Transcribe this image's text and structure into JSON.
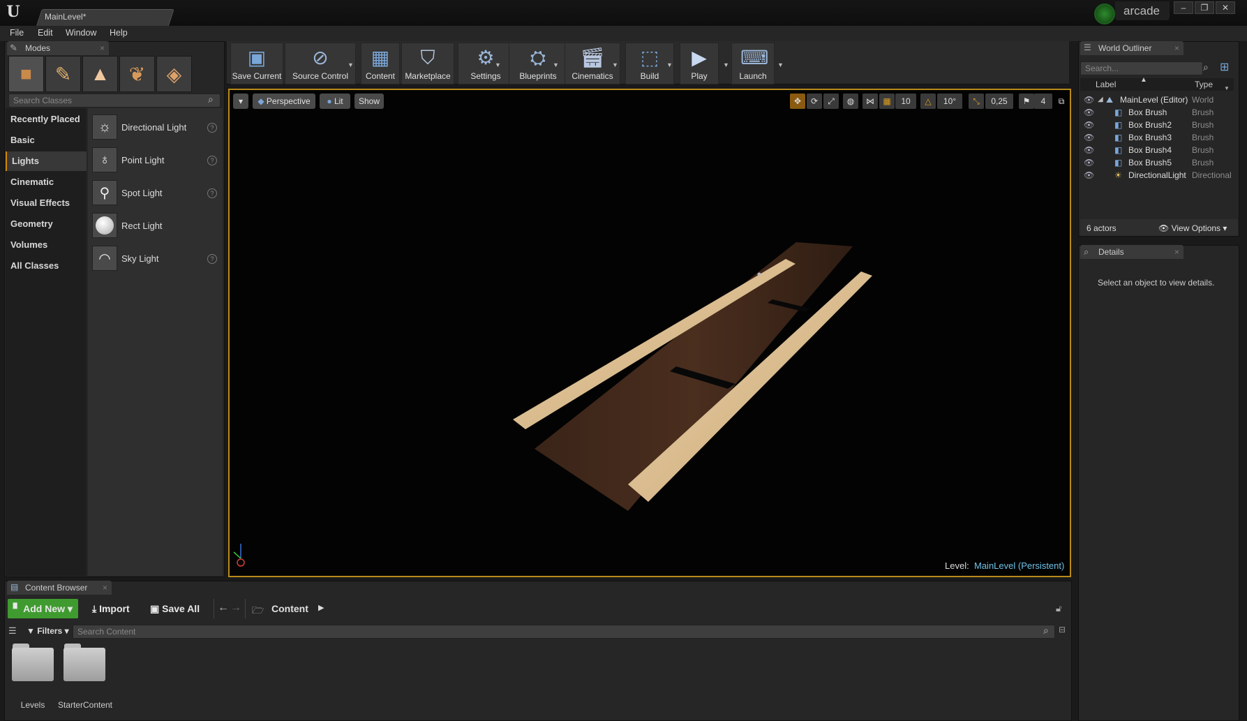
{
  "title_bar": {
    "logo": "U",
    "level_tab": "MainLevel*",
    "project_name": "arcade",
    "window_buttons": [
      "–",
      "❐",
      "✕"
    ]
  },
  "menu": [
    "File",
    "Edit",
    "Window",
    "Help"
  ],
  "modes": {
    "tab_label": "Modes",
    "search_placeholder": "Search Classes",
    "categories": [
      "Recently Placed",
      "Basic",
      "Lights",
      "Cinematic",
      "Visual Effects",
      "Geometry",
      "Volumes",
      "All Classes"
    ],
    "selected_category": "Lights",
    "items": [
      {
        "label": "Directional Light",
        "icon": "directional-light-icon",
        "help": true
      },
      {
        "label": "Point Light",
        "icon": "point-light-icon",
        "help": true
      },
      {
        "label": "Spot Light",
        "icon": "spot-light-icon",
        "help": true
      },
      {
        "label": "Rect Light",
        "icon": "rect-light-icon",
        "help": false
      },
      {
        "label": "Sky Light",
        "icon": "sky-light-icon",
        "help": true
      }
    ]
  },
  "toolbar": {
    "buttons": [
      "Save Current",
      "Source Control",
      "Content",
      "Marketplace",
      "Settings",
      "Blueprints",
      "Cinematics",
      "Build",
      "Play",
      "Launch"
    ]
  },
  "viewport": {
    "view_mode": "Perspective",
    "lighting": "Lit",
    "show": "Show",
    "grid_snap": "10",
    "rotation_snap": "10°",
    "scale_snap": "0,25",
    "camera_speed": "4",
    "level_label": "Level:",
    "level_value": "MainLevel (Persistent)"
  },
  "outliner": {
    "tab_label": "World Outliner",
    "search_placeholder": "Search...",
    "col_label": "Label",
    "col_type": "Type",
    "rows": [
      {
        "label": "MainLevel (Editor)",
        "type": "World"
      },
      {
        "label": "Box Brush",
        "type": "Brush"
      },
      {
        "label": "Box Brush2",
        "type": "Brush"
      },
      {
        "label": "Box Brush3",
        "type": "Brush"
      },
      {
        "label": "Box Brush4",
        "type": "Brush"
      },
      {
        "label": "Box Brush5",
        "type": "Brush"
      },
      {
        "label": "DirectionalLight",
        "type": "Directional"
      }
    ],
    "actor_count": "6 actors",
    "view_options": "View Options"
  },
  "details": {
    "tab_label": "Details",
    "empty_message": "Select an object to view details."
  },
  "content_browser": {
    "tab_label": "Content Browser",
    "add_new": "Add New",
    "import": "Import",
    "save_all": "Save All",
    "path": "Content",
    "filters": "Filters",
    "search_placeholder": "Search Content",
    "folders": [
      "Levels",
      "StarterContent"
    ]
  },
  "colors": {
    "accent_orange": "#d08a00",
    "viewport_border": "#b88a1a",
    "add_new_green": "#3f9b2f",
    "level_link": "#6fc2e6"
  }
}
